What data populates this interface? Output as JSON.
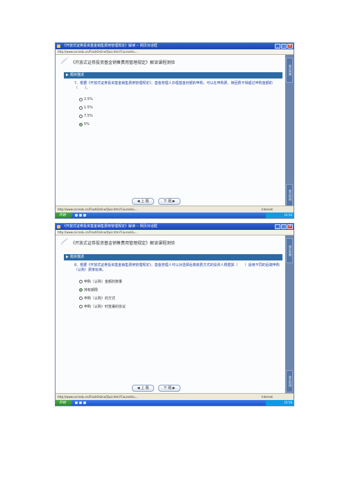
{
  "screens": [
    {
      "window_title": "《开放式证券投资基金销售费用管理规定》解读 -- 网页对话框",
      "address": "http://www.csrcedu.cn/FlashOnline/Quiz.htm?CourseId=...",
      "course_title": "《开放式证券投资基金销售费用管理规定》解读课程测验",
      "section_label": "题目描述",
      "question": "7、根据《开放式证券投资基金销售费用管理规定》，基金管理人办理基金份额的申购，可以在申购费、赎回费不得超过申购金额的（　　）。",
      "options": [
        {
          "label": "2.5%",
          "checked": false
        },
        {
          "label": "1.5%",
          "checked": false
        },
        {
          "label": "7.5%",
          "checked": false
        },
        {
          "label": "5%",
          "checked": true
        }
      ],
      "prev_label": "上 题",
      "next_label": "下 题",
      "side_tab_top": "显示列表",
      "side_tab_bottom": "显示时间",
      "status_text": "http://www.csrcedu.cn/FlashOnline/Quiz.htm?CourseId=...",
      "zone_text": "Internet",
      "start_label": "开始",
      "clock": "10:56"
    },
    {
      "window_title": "《开放式证券投资基金销售费用管理规定》解读 -- 网页对话框",
      "address": "http://www.csrcedu.cn/FlashOnline/Quiz.htm?CourseId=...",
      "course_title": "《开放式证券投资基金销售费用管理规定》解读课程测验",
      "section_label": "题目描述",
      "question": "8、根据《开放式证券投资基金销售费用管理规定》，基金管理人可以对选择后端收费方式的投资人根据其（　　）适用不同的后端申购（认购）费率标准。",
      "options": [
        {
          "label": "申购（认购）金额的数量",
          "checked": false
        },
        {
          "label": "持有期限",
          "checked": true
        },
        {
          "label": "申购（认购）的方式",
          "checked": false
        },
        {
          "label": "申购（认购）时签署的协议",
          "checked": false
        }
      ],
      "prev_label": "上 题",
      "next_label": "下 题",
      "side_tab_top": "显示列表",
      "side_tab_bottom": "显示时间",
      "status_text": "http://www.csrcedu.cn/FlashOnline/Quiz.htm?CourseId=...",
      "zone_text": "Internet",
      "start_label": "开始",
      "clock": "10:58"
    }
  ]
}
